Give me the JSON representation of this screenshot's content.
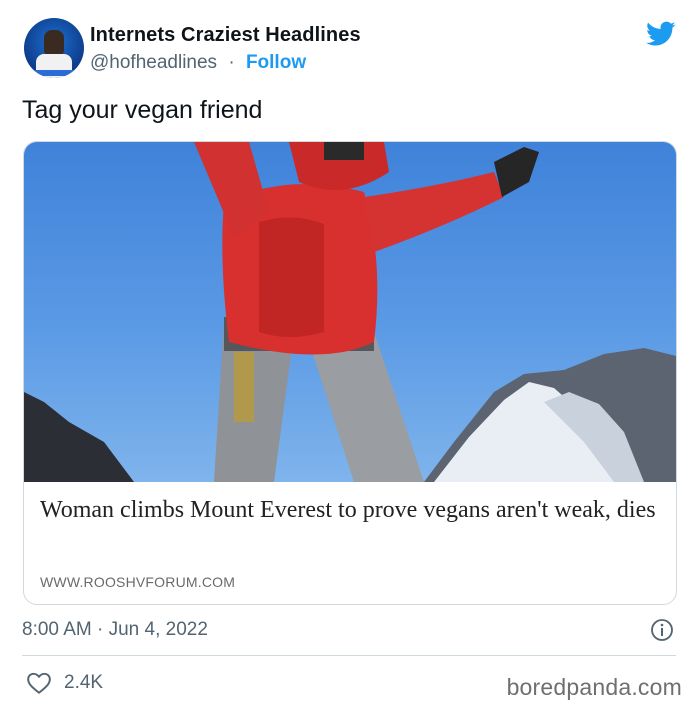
{
  "author": {
    "display_name": "Internets Craziest Headlines",
    "handle": "@hofheadlines",
    "separator": "·",
    "follow_label": "Follow"
  },
  "tweet": {
    "text": "Tag your vegan friend",
    "timestamp": "8:00 AM · Jun 4, 2022",
    "like_count": "2.4K"
  },
  "card": {
    "headline": "Woman climbs Mount Everest to prove vegans aren't weak, dies",
    "source": "WWW.ROOSHVFORUM.COM"
  },
  "watermark": "boredpanda.com",
  "colors": {
    "twitter_blue": "#1d9bf0",
    "secondary_text": "#536471",
    "border": "#cfd9de"
  },
  "icons": {
    "brand": "twitter-bird-icon",
    "info": "info-icon",
    "like": "heart-icon"
  }
}
